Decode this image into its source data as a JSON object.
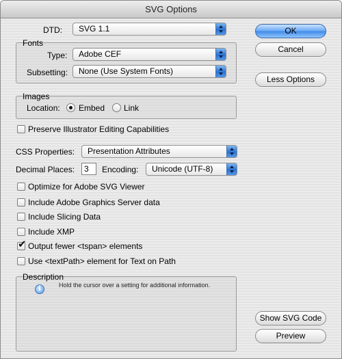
{
  "window": {
    "title": "SVG Options"
  },
  "dtd": {
    "label": "DTD:",
    "value": "SVG 1.1"
  },
  "fonts": {
    "group_title": "Fonts",
    "type_label": "Type:",
    "type_value": "Adobe CEF",
    "subsetting_label": "Subsetting:",
    "subsetting_value": "None (Use System Fonts)"
  },
  "images": {
    "group_title": "Images",
    "location_label": "Location:",
    "embed_label": "Embed",
    "link_label": "Link",
    "selected": "Embed"
  },
  "preserve": {
    "label": "Preserve Illustrator Editing Capabilities",
    "checked": false
  },
  "css": {
    "label": "CSS Properties:",
    "value": "Presentation Attributes"
  },
  "decimal": {
    "label": "Decimal Places:",
    "value": "3"
  },
  "encoding": {
    "label": "Encoding:",
    "value": "Unicode (UTF-8)"
  },
  "options": [
    {
      "label": "Optimize for Adobe SVG Viewer",
      "checked": false
    },
    {
      "label": "Include Adobe Graphics Server data",
      "checked": false
    },
    {
      "label": "Include Slicing Data",
      "checked": false
    },
    {
      "label": "Include XMP",
      "checked": false
    },
    {
      "label": "Output fewer <tspan> elements",
      "checked": true
    },
    {
      "label": "Use <textPath> element for Text on Path",
      "checked": false
    }
  ],
  "description": {
    "group_title": "Description",
    "text": "Hold the cursor over a setting for additional information.",
    "icon": "info-icon"
  },
  "buttons": {
    "ok": "OK",
    "cancel": "Cancel",
    "less_options": "Less Options",
    "show_svg_code": "Show SVG Code",
    "preview": "Preview"
  },
  "checkmark_glyph": "✔",
  "colors": {
    "accent": "#3f8ae8",
    "window_bg": "#e4e4e4"
  }
}
